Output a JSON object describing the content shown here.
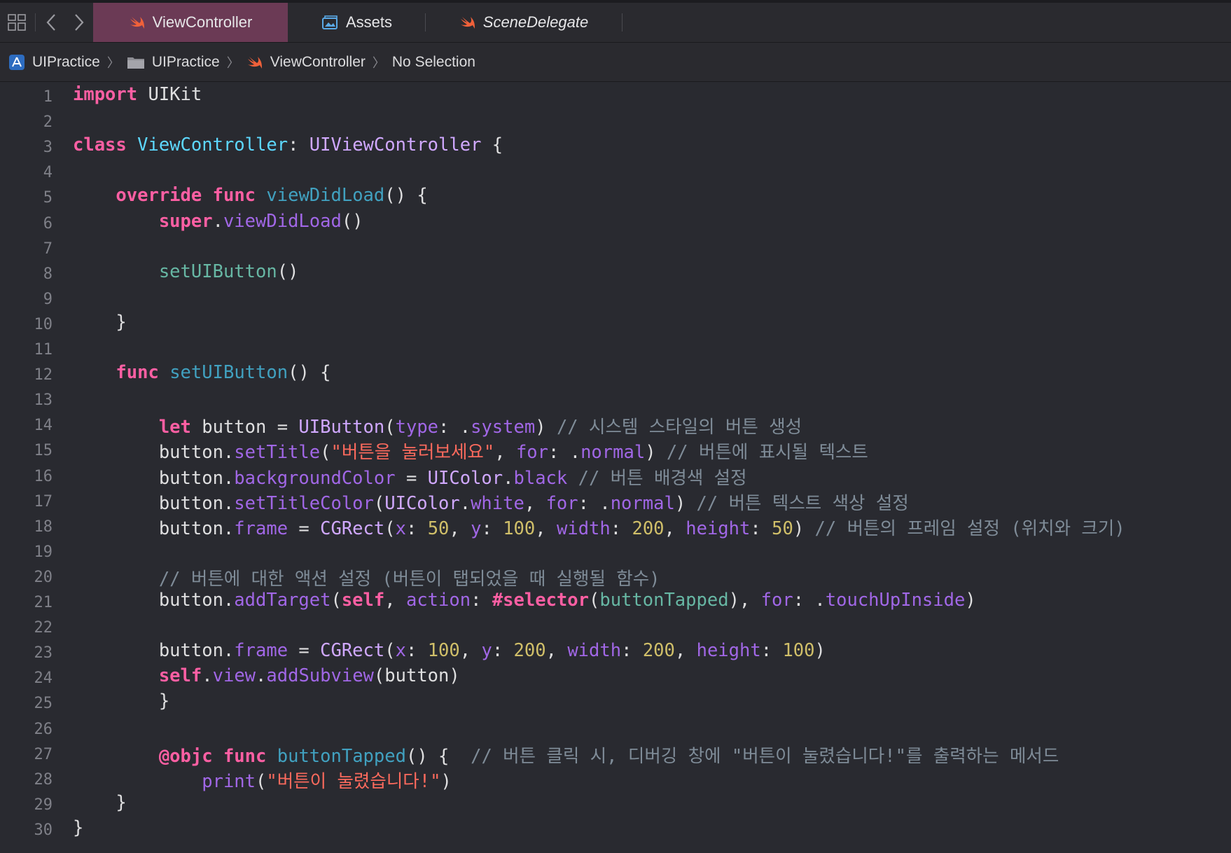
{
  "tabbar": {
    "tabs": [
      {
        "label": "ViewController",
        "icon": "swift-icon",
        "active": true,
        "italic": false
      },
      {
        "label": "Assets",
        "icon": "assets-icon",
        "active": false,
        "italic": false
      },
      {
        "label": "SceneDelegate",
        "icon": "swift-icon",
        "active": false,
        "italic": true
      }
    ]
  },
  "breadcrumb": {
    "items": [
      {
        "label": "UIPractice",
        "icon": "project-icon"
      },
      {
        "label": "UIPractice",
        "icon": "folder-icon"
      },
      {
        "label": "ViewController",
        "icon": "swift-icon"
      },
      {
        "label": "No Selection",
        "icon": ""
      }
    ]
  },
  "editor": {
    "colors": {
      "background": "#292a30",
      "keyword": "#fc5fa3",
      "string": "#fc6a5d",
      "number": "#d0bf69",
      "comment": "#7f8c98",
      "type": "#d0a8ff",
      "member": "#a167e6"
    },
    "lines": [
      [
        [
          "import",
          "kw"
        ],
        [
          " UIKit",
          ""
        ]
      ],
      [],
      [
        [
          "class",
          "kw"
        ],
        [
          " ",
          ""
        ],
        [
          "ViewController",
          "tdecl"
        ],
        [
          ": ",
          ""
        ],
        [
          "UIViewController",
          "ty"
        ],
        [
          " {",
          ""
        ]
      ],
      [],
      [
        [
          "    ",
          ""
        ],
        [
          "override",
          "kw"
        ],
        [
          " ",
          ""
        ],
        [
          "func",
          "kw"
        ],
        [
          " ",
          ""
        ],
        [
          "viewDidLoad",
          "fdecl"
        ],
        [
          "() {",
          ""
        ]
      ],
      [
        [
          "        ",
          ""
        ],
        [
          "super",
          "kw"
        ],
        [
          ".",
          ""
        ],
        [
          "viewDidLoad",
          "mem"
        ],
        [
          "()",
          ""
        ]
      ],
      [],
      [
        [
          "        ",
          ""
        ],
        [
          "setUIButton",
          "call"
        ],
        [
          "()",
          ""
        ]
      ],
      [],
      [
        [
          "    }",
          ""
        ]
      ],
      [],
      [
        [
          "    ",
          ""
        ],
        [
          "func",
          "kw"
        ],
        [
          " ",
          ""
        ],
        [
          "setUIButton",
          "fdecl"
        ],
        [
          "() {",
          ""
        ]
      ],
      [],
      [
        [
          "        ",
          ""
        ],
        [
          "let",
          "kw"
        ],
        [
          " button = ",
          ""
        ],
        [
          "UIButton",
          "ty"
        ],
        [
          "(",
          ""
        ],
        [
          "type",
          "mem"
        ],
        [
          ": .",
          ""
        ],
        [
          "system",
          "mem"
        ],
        [
          ") ",
          ""
        ],
        [
          "// 시스템 스타일의 버튼 생성",
          "cmt"
        ]
      ],
      [
        [
          "        button.",
          ""
        ],
        [
          "setTitle",
          "mem"
        ],
        [
          "(",
          ""
        ],
        [
          "\"버튼을 눌러보세요\"",
          "str"
        ],
        [
          ", ",
          ""
        ],
        [
          "for",
          "mem"
        ],
        [
          ": .",
          ""
        ],
        [
          "normal",
          "mem"
        ],
        [
          ") ",
          ""
        ],
        [
          "// 버튼에 표시될 텍스트",
          "cmt"
        ]
      ],
      [
        [
          "        button.",
          ""
        ],
        [
          "backgroundColor",
          "mem"
        ],
        [
          " = ",
          ""
        ],
        [
          "UIColor",
          "ty"
        ],
        [
          ".",
          ""
        ],
        [
          "black",
          "mem"
        ],
        [
          " ",
          ""
        ],
        [
          "// 버튼 배경색 설정",
          "cmt"
        ]
      ],
      [
        [
          "        button.",
          ""
        ],
        [
          "setTitleColor",
          "mem"
        ],
        [
          "(",
          ""
        ],
        [
          "UIColor",
          "ty"
        ],
        [
          ".",
          ""
        ],
        [
          "white",
          "mem"
        ],
        [
          ", ",
          ""
        ],
        [
          "for",
          "mem"
        ],
        [
          ": .",
          ""
        ],
        [
          "normal",
          "mem"
        ],
        [
          ") ",
          ""
        ],
        [
          "// 버튼 텍스트 색상 설정",
          "cmt"
        ]
      ],
      [
        [
          "        button.",
          ""
        ],
        [
          "frame",
          "mem"
        ],
        [
          " = ",
          ""
        ],
        [
          "CGRect",
          "ty"
        ],
        [
          "(",
          ""
        ],
        [
          "x",
          "mem"
        ],
        [
          ": ",
          ""
        ],
        [
          "50",
          "num"
        ],
        [
          ", ",
          ""
        ],
        [
          "y",
          "mem"
        ],
        [
          ": ",
          ""
        ],
        [
          "100",
          "num"
        ],
        [
          ", ",
          ""
        ],
        [
          "width",
          "mem"
        ],
        [
          ": ",
          ""
        ],
        [
          "200",
          "num"
        ],
        [
          ", ",
          ""
        ],
        [
          "height",
          "mem"
        ],
        [
          ": ",
          ""
        ],
        [
          "50",
          "num"
        ],
        [
          ") ",
          ""
        ],
        [
          "// 버튼의 프레임 설정 (위치와 크기)",
          "cmt"
        ]
      ],
      [],
      [
        [
          "        ",
          ""
        ],
        [
          "// 버튼에 대한 액션 설정 (버튼이 탭되었을 때 실행될 함수)",
          "cmt"
        ]
      ],
      [
        [
          "        button.",
          ""
        ],
        [
          "addTarget",
          "mem"
        ],
        [
          "(",
          ""
        ],
        [
          "self",
          "kw"
        ],
        [
          ", ",
          ""
        ],
        [
          "action",
          "mem"
        ],
        [
          ": ",
          ""
        ],
        [
          "#selector",
          "kw"
        ],
        [
          "(",
          ""
        ],
        [
          "buttonTapped",
          "call"
        ],
        [
          "), ",
          ""
        ],
        [
          "for",
          "mem"
        ],
        [
          ": .",
          ""
        ],
        [
          "touchUpInside",
          "mem"
        ],
        [
          ")",
          ""
        ]
      ],
      [],
      [
        [
          "        button.",
          ""
        ],
        [
          "frame",
          "mem"
        ],
        [
          " = ",
          ""
        ],
        [
          "CGRect",
          "ty"
        ],
        [
          "(",
          ""
        ],
        [
          "x",
          "mem"
        ],
        [
          ": ",
          ""
        ],
        [
          "100",
          "num"
        ],
        [
          ", ",
          ""
        ],
        [
          "y",
          "mem"
        ],
        [
          ": ",
          ""
        ],
        [
          "200",
          "num"
        ],
        [
          ", ",
          ""
        ],
        [
          "width",
          "mem"
        ],
        [
          ": ",
          ""
        ],
        [
          "200",
          "num"
        ],
        [
          ", ",
          ""
        ],
        [
          "height",
          "mem"
        ],
        [
          ": ",
          ""
        ],
        [
          "100",
          "num"
        ],
        [
          ")",
          ""
        ]
      ],
      [
        [
          "        ",
          ""
        ],
        [
          "self",
          "kw"
        ],
        [
          ".",
          ""
        ],
        [
          "view",
          "mem"
        ],
        [
          ".",
          ""
        ],
        [
          "addSubview",
          "mem"
        ],
        [
          "(button)",
          ""
        ]
      ],
      [
        [
          "        }",
          ""
        ]
      ],
      [],
      [
        [
          "        ",
          ""
        ],
        [
          "@objc",
          "attr"
        ],
        [
          " ",
          ""
        ],
        [
          "func",
          "kw"
        ],
        [
          " ",
          ""
        ],
        [
          "buttonTapped",
          "fdecl"
        ],
        [
          "() {  ",
          ""
        ],
        [
          "// 버튼 클릭 시, 디버깅 창에 \"버튼이 눌렸습니다!\"를 출력하는 메서드",
          "cmt"
        ]
      ],
      [
        [
          "            ",
          ""
        ],
        [
          "print",
          "mem"
        ],
        [
          "(",
          ""
        ],
        [
          "\"버튼이 눌렸습니다!\"",
          "str"
        ],
        [
          ")",
          ""
        ]
      ],
      [
        [
          "    }",
          ""
        ]
      ],
      [
        [
          "}",
          ""
        ]
      ]
    ]
  }
}
